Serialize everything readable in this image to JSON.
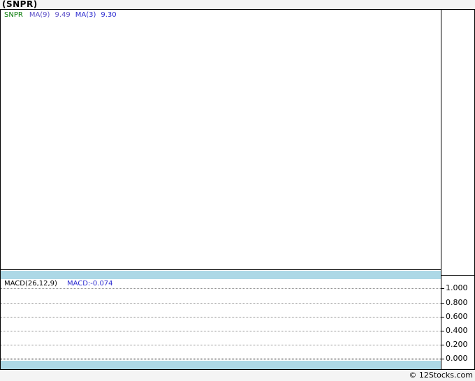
{
  "page": {
    "copyright": "© 12Stocks.com"
  },
  "header": {
    "title": "(SNPR)"
  },
  "colors": {
    "background": "#f4f4f4",
    "frame_border": "#000000",
    "band": "#add8e6",
    "symbol": "#007700",
    "ma9": "#5b4ec7",
    "ma3": "#2a2ad0",
    "macd_value": "#2a2ad0",
    "grid": "#909090"
  },
  "main_chart": {
    "legend": {
      "symbol": "SNPR",
      "ma9_label": "MA(9)",
      "ma9_value": "9.49",
      "ma3_label": "MA(3)",
      "ma3_value": "9.30"
    }
  },
  "macd_panel": {
    "legend_label": "MACD(26,12,9)",
    "legend_value": "MACD:-0.074",
    "axis_ticks": [
      "1.000",
      "0.800",
      "0.600",
      "0.400",
      "0.200",
      "0.000"
    ]
  },
  "chart_data": [
    {
      "type": "line",
      "title": "(SNPR)",
      "panel": "price",
      "series": [
        {
          "name": "SNPR",
          "values": []
        },
        {
          "name": "MA(9)",
          "last_value": 9.49
        },
        {
          "name": "MA(3)",
          "last_value": 9.3
        }
      ],
      "note": "price panel is empty - no candles or lines plotted, price axis has no tick labels"
    },
    {
      "type": "line",
      "title": "MACD(26,12,9)",
      "panel": "indicator",
      "series": [
        {
          "name": "MACD",
          "last_value": -0.074,
          "values": []
        }
      ],
      "ylim": [
        0.0,
        1.0
      ],
      "yticks": [
        1.0,
        0.8,
        0.6,
        0.4,
        0.2,
        0.0
      ],
      "grid": "dotted horizontal lines, zero line emphasized",
      "legend_position": "top-left",
      "axis_position": "right"
    }
  ]
}
